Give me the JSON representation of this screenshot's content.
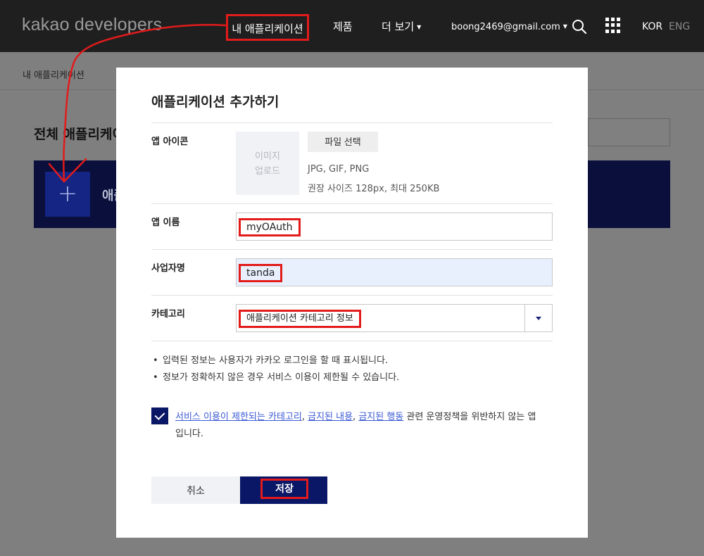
{
  "nav": {
    "logo": "kakao developers",
    "my_apps": "내 애플리케이션",
    "products": "제품",
    "more": "더 보기",
    "account": "boong2469@gmail.com",
    "lang_kor": "KOR",
    "lang_eng": "ENG"
  },
  "background": {
    "breadcrumb": "내 애플리케이션",
    "heading": "전체 애플리케이션",
    "panel_text": "애플리케이션 추가하기",
    "add_tile": "+"
  },
  "modal": {
    "title": "애플리케이션 추가하기",
    "icon": {
      "label": "앱 아이콘",
      "upload_line1": "이미지",
      "upload_line2": "업로드",
      "file_button": "파일 선택",
      "hint_formats": "JPG, GIF, PNG",
      "hint_size": "권장 사이즈 128px, 최대 250KB"
    },
    "app_name": {
      "label": "앱 이름",
      "value": "myOAuth"
    },
    "company": {
      "label": "사업자명",
      "value": "tanda"
    },
    "category": {
      "label": "카테고리",
      "value": "애플리케이션 카테고리 정보"
    },
    "notes": [
      "입력된 정보는 사용자가 카카오 로그인을 할 때 표시됩니다.",
      "정보가 정확하지 않은 경우 서비스 이용이 제한될 수 있습니다."
    ],
    "agreement": {
      "link1": "서비스 이용이 제한되는 카테고리",
      "sep1": ", ",
      "link2": "금지된 내용",
      "sep2": ", ",
      "link3": "금지된 행동",
      "text_after": " 관련 운영정책을 위반하지 않는 앱",
      "text_line2": "입니다.",
      "checked": true
    },
    "cancel_label": "취소",
    "save_label": "저장"
  },
  "colors": {
    "topbar": "#1f1f1f",
    "primary": "#0a1666",
    "highlight": "#e21b1b",
    "link": "#3c5ad6"
  },
  "icons": [
    "search-icon",
    "apps-grid-icon",
    "plus-icon",
    "checkmark-icon",
    "dropdown-arrow-icon",
    "annotation-arrow"
  ]
}
